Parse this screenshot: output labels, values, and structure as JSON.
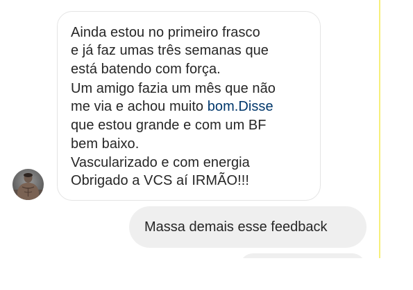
{
  "conversation": {
    "received_message": {
      "lines": [
        "Ainda estou no primeiro frasco",
        "e já faz umas três semanas que",
        "está batendo com força.",
        "Um amigo fazia um mês que não",
        "me via e achou muito ",
        "que estou grande e com um BF",
        "bem baixo.",
        "Vascularizado e com energia",
        "Obrigado a VCS aí IRMÃO!!!"
      ],
      "link_text": "bom.Disse"
    },
    "sent_message": {
      "text": "Massa demais esse feedback"
    }
  },
  "sender": {
    "avatar_icon": "profile-photo-avatar"
  },
  "colors": {
    "received_bubble_border": "#e4e4e4",
    "sent_bubble_bg": "#efefef",
    "text": "#262626",
    "link": "#00376b",
    "edge_accent": "#f6ef7a"
  }
}
